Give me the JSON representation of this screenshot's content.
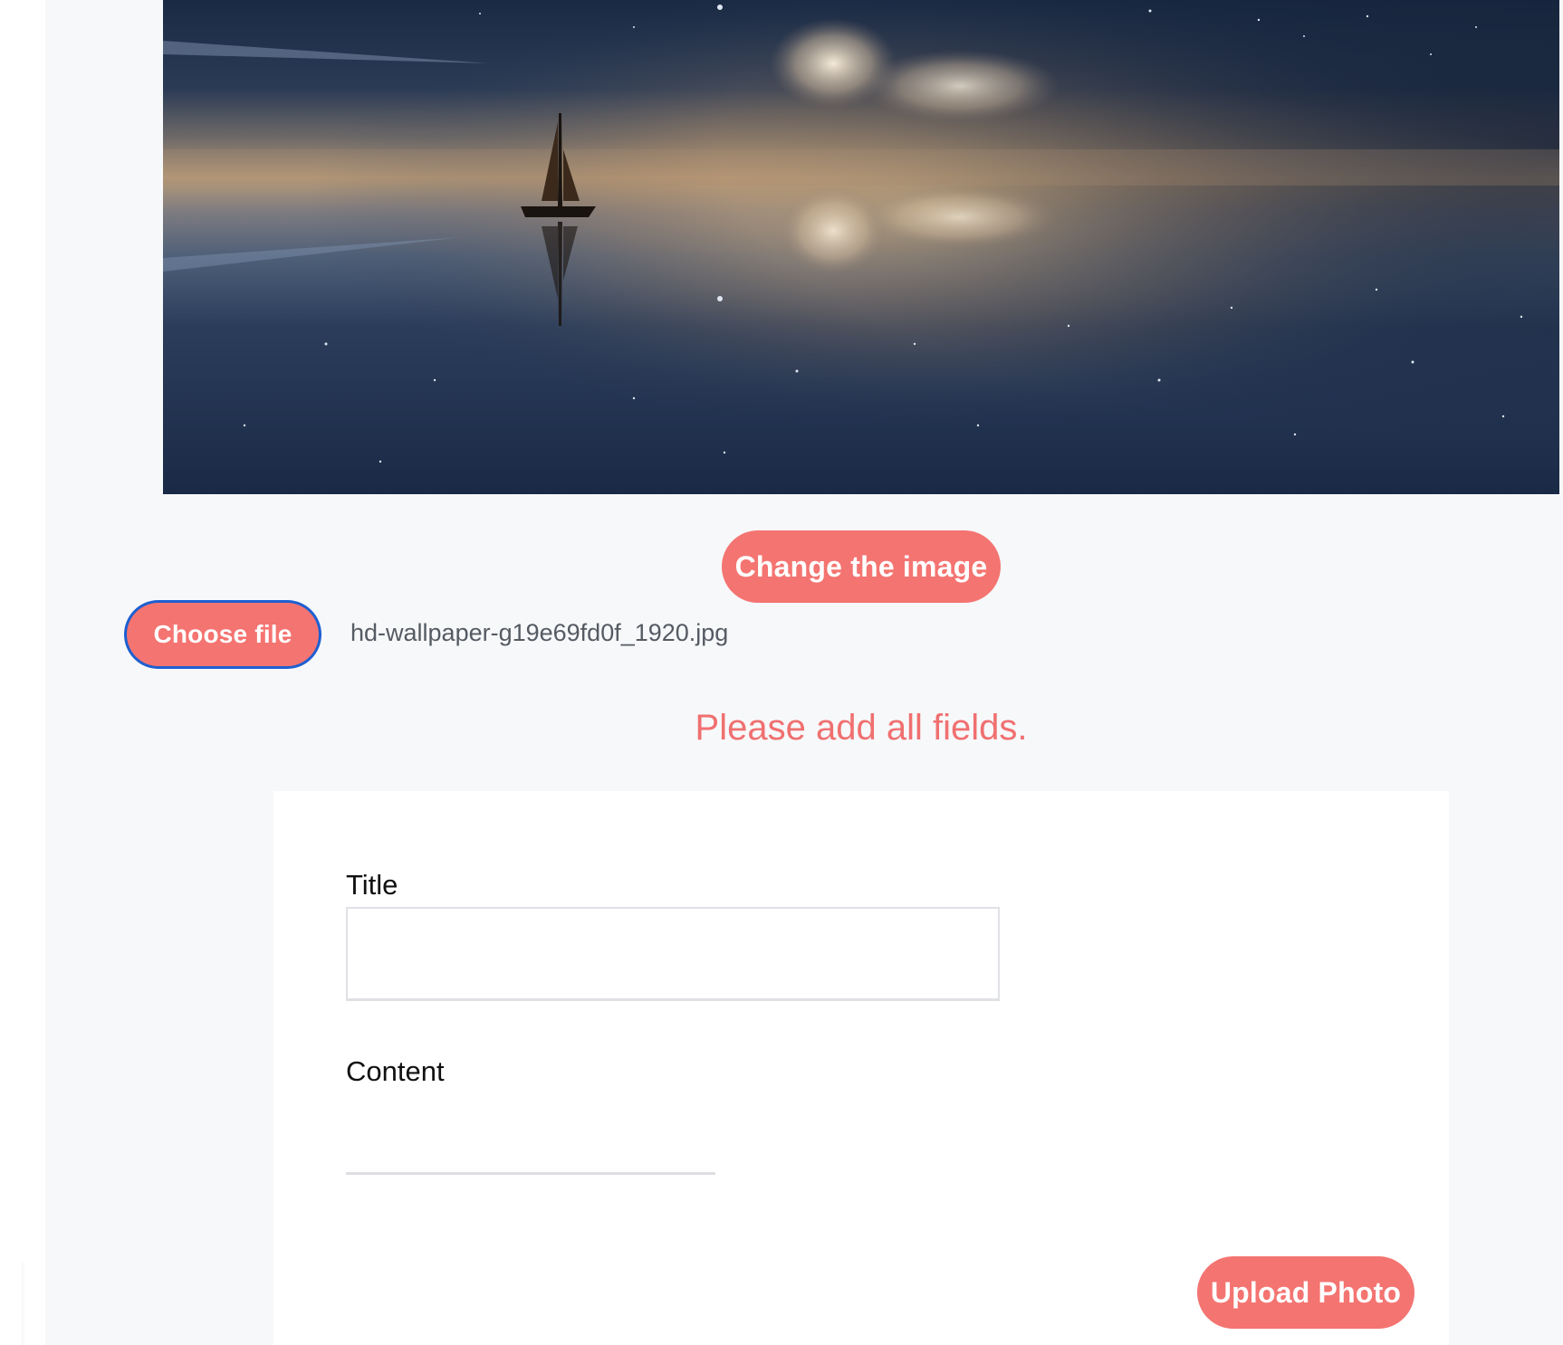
{
  "hero": {
    "image_name": "night-sea-sailboat-image"
  },
  "actions": {
    "change_image_label": "Change the image",
    "choose_file_label": "Choose file",
    "selected_file": "hd-wallpaper-g19e69fd0f_1920.jpg"
  },
  "message": {
    "error_text": "Please add all fields."
  },
  "form": {
    "title_label": "Title",
    "title_value": "",
    "content_label": "Content",
    "content_value": "",
    "upload_label": "Upload Photo"
  },
  "colors": {
    "accent": "#f47471",
    "error": "#f07070",
    "focus_ring": "#1d5fd1",
    "page_bg": "#f7f8fa"
  }
}
